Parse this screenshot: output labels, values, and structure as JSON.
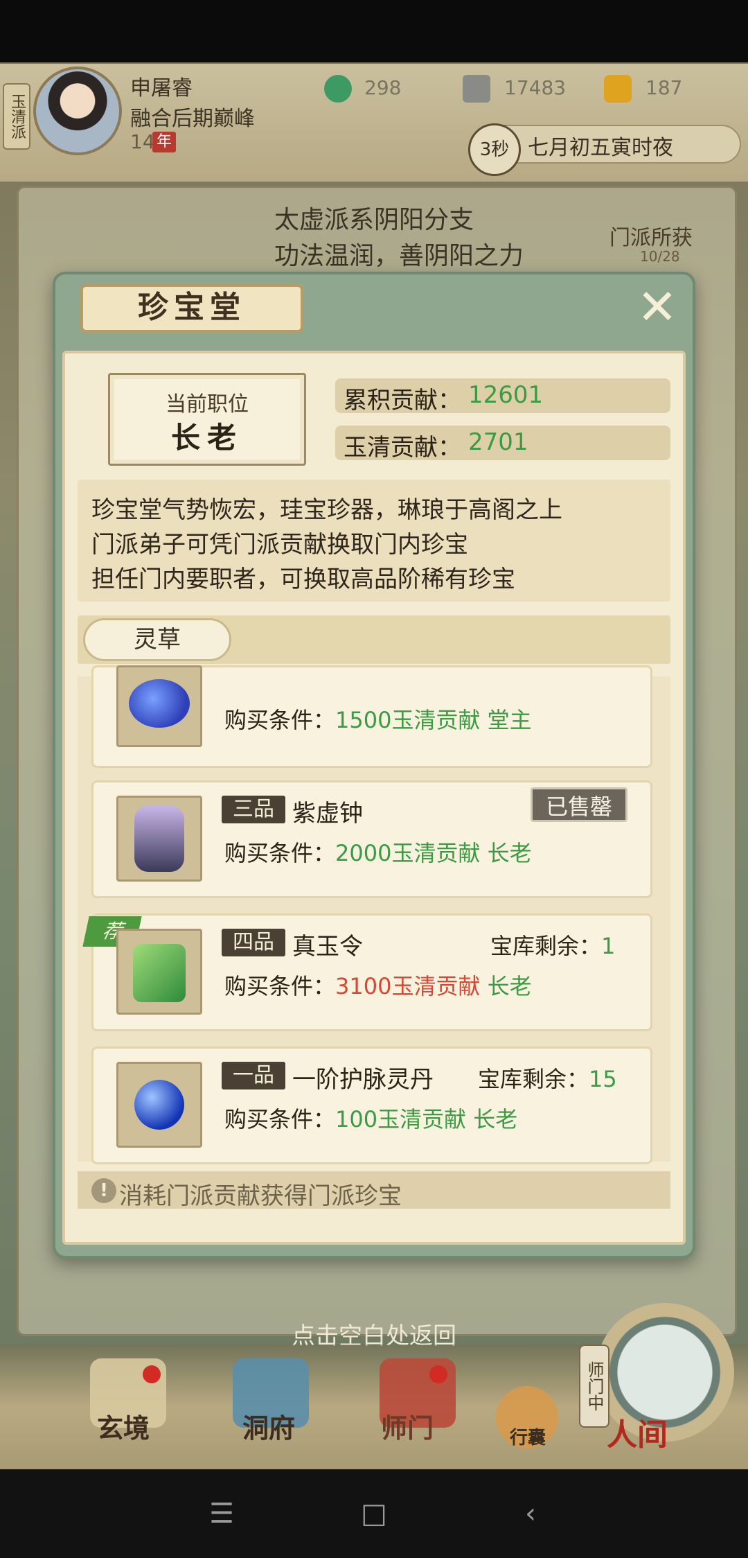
{
  "player": {
    "sect_tag": "玉清派",
    "name": "申屠睿",
    "realm": "融合后期巅峰",
    "age": "14",
    "age_badge": "年"
  },
  "currencies": [
    {
      "icon": "jade-spirit-icon",
      "value": "298"
    },
    {
      "icon": "copper-coin-icon",
      "value": "17483"
    },
    {
      "icon": "gold-ingot-icon",
      "value": "187"
    }
  ],
  "clock": {
    "seconds": "3秒",
    "date_text": "七月初五寅时夜"
  },
  "sect_info": {
    "line1": "太虚派系阴阳分支",
    "line2": "功法温润，善阴阳之力",
    "gain_label": "门派所获",
    "gain_count": "10/28"
  },
  "modal": {
    "title": "珍宝堂",
    "position_label": "当前职位",
    "position_value": "长老",
    "total_contribution_label": "累积贡献：",
    "total_contribution_value": "12601",
    "yuqing_contribution_label": "玉清贡献：",
    "yuqing_contribution_value": "2701",
    "description": [
      "珍宝堂气势恢宏，珪宝珍器，琳琅于高阁之上",
      "门派弟子可凭门派贡献换取门内珍宝",
      "担任门内要职者，可换取高品阶稀有珍宝"
    ],
    "category": "灵草",
    "items": [
      {
        "grade": "",
        "name": "",
        "stock_label": "",
        "stock": "",
        "cond_label": "购买条件：",
        "cost": "1500玉清贡献",
        "role": "堂主",
        "sold": "",
        "recommended": false
      },
      {
        "grade": "三品",
        "name": "紫虚钟",
        "stock_label": "",
        "stock": "",
        "cond_label": "购买条件：",
        "cost": "2000玉清贡献",
        "role": "长老",
        "sold": "已售罄",
        "recommended": false
      },
      {
        "grade": "四品",
        "name": "真玉令",
        "stock_label": "宝库剩余：",
        "stock": "1",
        "cond_label": "购买条件：",
        "cost": "3100玉清贡献",
        "role": "长老",
        "sold": "",
        "recommended": true,
        "rec_label": "荐"
      },
      {
        "grade": "一品",
        "name": "一阶护脉灵丹",
        "stock_label": "宝库剩余：",
        "stock": "15",
        "cond_label": "购买条件：",
        "cost": "100玉清贡献",
        "role": "长老",
        "sold": "",
        "recommended": false
      }
    ],
    "hint": "消耗门派贡献获得门派珍宝"
  },
  "return_hint": "点击空白处返回",
  "bottom_nav": {
    "xuanjing": "玄境",
    "dongfu": "洞府",
    "shimen": "师门",
    "xingnang": "行囊",
    "renjian": "人间",
    "master_badge": "师门中"
  },
  "colors": {
    "green_value": "#3c9a44",
    "red_cost": "#d24a35",
    "accent_dark": "#4a4034"
  }
}
